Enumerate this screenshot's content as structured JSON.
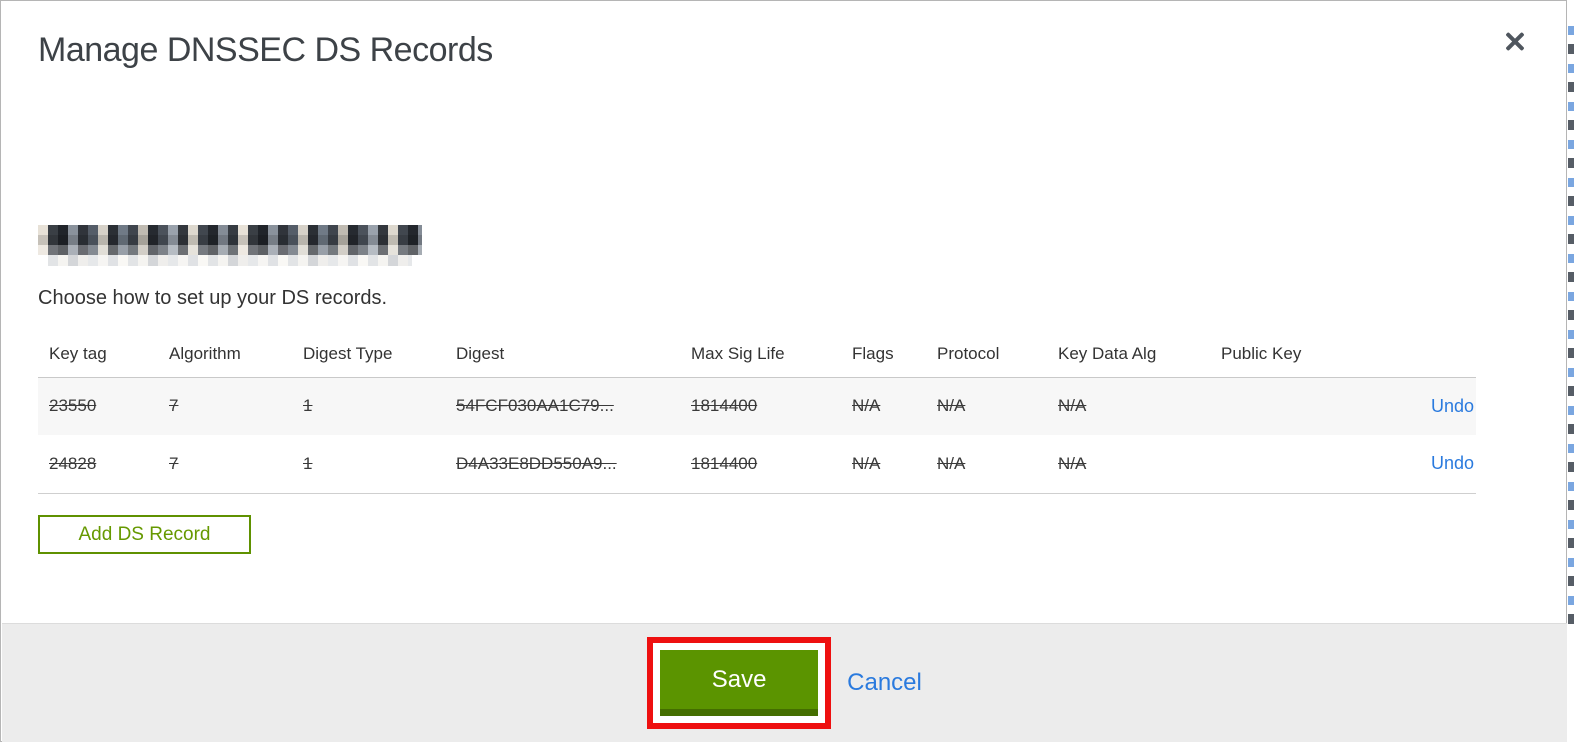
{
  "modal": {
    "title": "Manage DNSSEC DS Records",
    "domain_redacted": true,
    "instruction": "Choose how to set up your DS records.",
    "table": {
      "headers": [
        "Key tag",
        "Algorithm",
        "Digest Type",
        "Digest",
        "Max Sig Life",
        "Flags",
        "Protocol",
        "Key Data Alg",
        "Public Key"
      ],
      "rows": [
        {
          "cells": [
            "23550",
            "7",
            "1",
            "54FCF030AA1C79...",
            "1814400",
            "N/A",
            "N/A",
            "N/A",
            ""
          ],
          "struck": true,
          "action_label": "Undo"
        },
        {
          "cells": [
            "24828",
            "7",
            "1",
            "D4A33E8DD550A9...",
            "1814400",
            "N/A",
            "N/A",
            "N/A",
            ""
          ],
          "struck": true,
          "action_label": "Undo"
        }
      ]
    },
    "add_ds_record_label": "Add DS Record",
    "footer": {
      "save_label": "Save",
      "cancel_label": "Cancel"
    }
  },
  "colors": {
    "accent_green": "#669900",
    "save_button_green": "#5b9400",
    "save_button_green_dark": "#446e00",
    "link_blue": "#2a7ade",
    "annotation_red": "#ee1010",
    "footer_background": "#ececec",
    "row_stripe": "#f7f7f7"
  }
}
